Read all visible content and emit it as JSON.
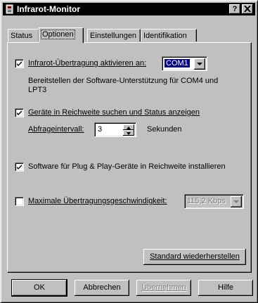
{
  "window": {
    "title": "Infrarot-Monitor",
    "help_glyph": "?",
    "close_glyph": "✕"
  },
  "tabs": [
    {
      "label": "Status"
    },
    {
      "label": "Optionen",
      "active": true
    },
    {
      "label": "Einstellungen"
    },
    {
      "label": "Identifikation"
    }
  ],
  "options": {
    "infrared_enable": {
      "checked": true,
      "label": "Infrarot-Übertragung aktivieren an:",
      "port_value": "COM1"
    },
    "support_note": {
      "line1": "Bereitstellen der Software-Unterstützung für COM4 und",
      "line2": "LPT3"
    },
    "scan_devices": {
      "checked": true,
      "label": "Geräte in Reichweite suchen und Status anzeigen"
    },
    "poll_interval": {
      "label": "Abfrageintervall:",
      "value": "3",
      "unit": "Sekunden"
    },
    "plug_and_play": {
      "checked": true,
      "label": "Software für Plug & Play-Geräte in Reichweite installieren"
    },
    "max_speed": {
      "checked": false,
      "label": "Maximale Übertragungsgeschwindigkeit:",
      "value": "115,2 Kbps",
      "disabled": true
    },
    "restore_defaults_label": "Standard wiederherstellen"
  },
  "footer": {
    "ok": "OK",
    "cancel": "Abbrechen",
    "apply": "Übernehmen",
    "help": "Hilfe"
  }
}
